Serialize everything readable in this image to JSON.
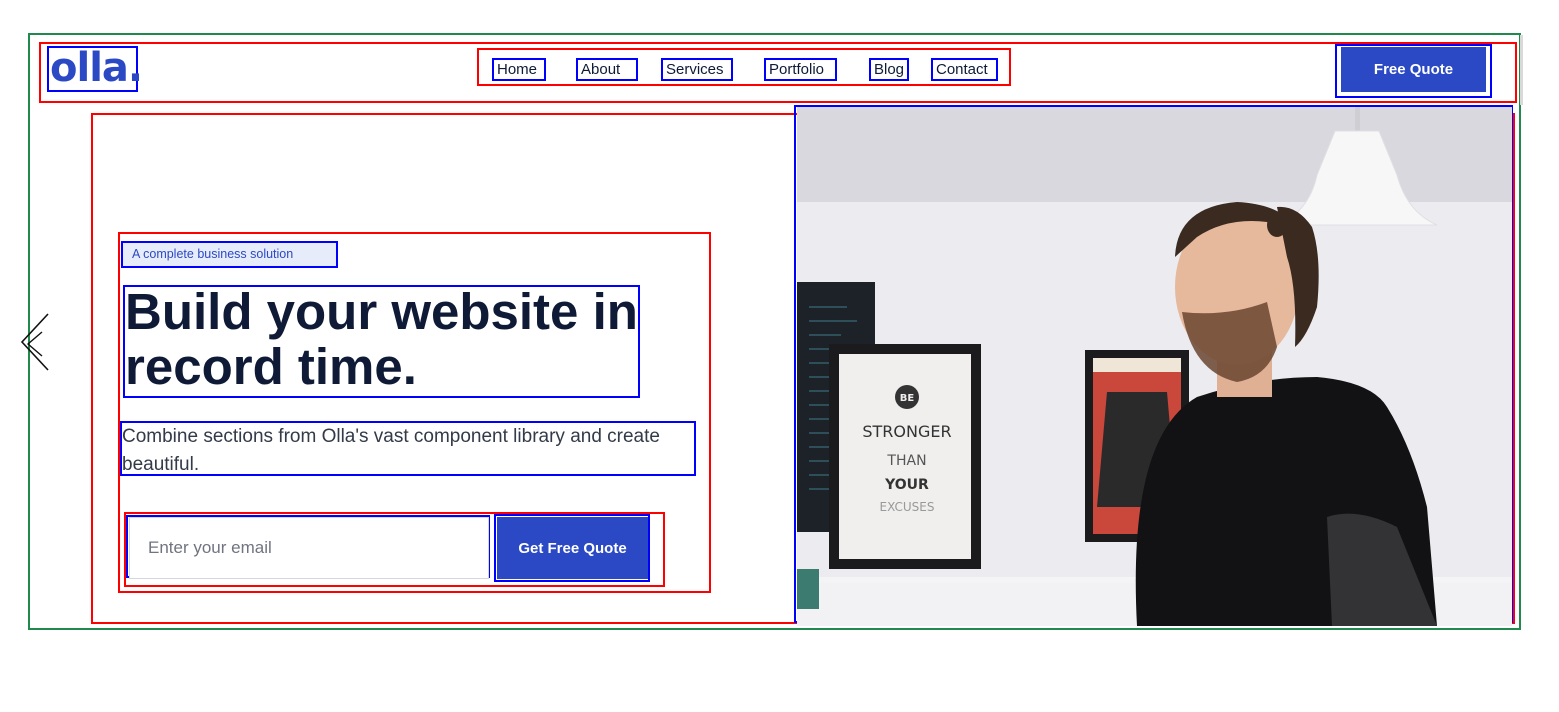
{
  "header": {
    "logo_text": "olla.",
    "nav_items": [
      {
        "label": "Home"
      },
      {
        "label": "About"
      },
      {
        "label": "Services"
      },
      {
        "label": "Portfolio"
      },
      {
        "label": "Blog"
      },
      {
        "label": "Contact"
      }
    ],
    "cta_label": "Free Quote"
  },
  "hero": {
    "tagline": "A complete business solution",
    "headline": "Build your website in record time.",
    "subtext": "Combine sections from Olla's vast component library and create beautiful.",
    "email_placeholder": "Enter your email",
    "submit_label": "Get Free Quote"
  },
  "poster": {
    "line1": "BE",
    "line2": "STRONGER",
    "line3": "THAN",
    "line4": "YOUR",
    "line5": "EXCUSES"
  },
  "colors": {
    "brand": "#2b49c4",
    "text": "#0e1a36",
    "tagline_bg": "#e7ecfb"
  },
  "icons": {
    "carousel_prev": "chevron-left-icon"
  }
}
